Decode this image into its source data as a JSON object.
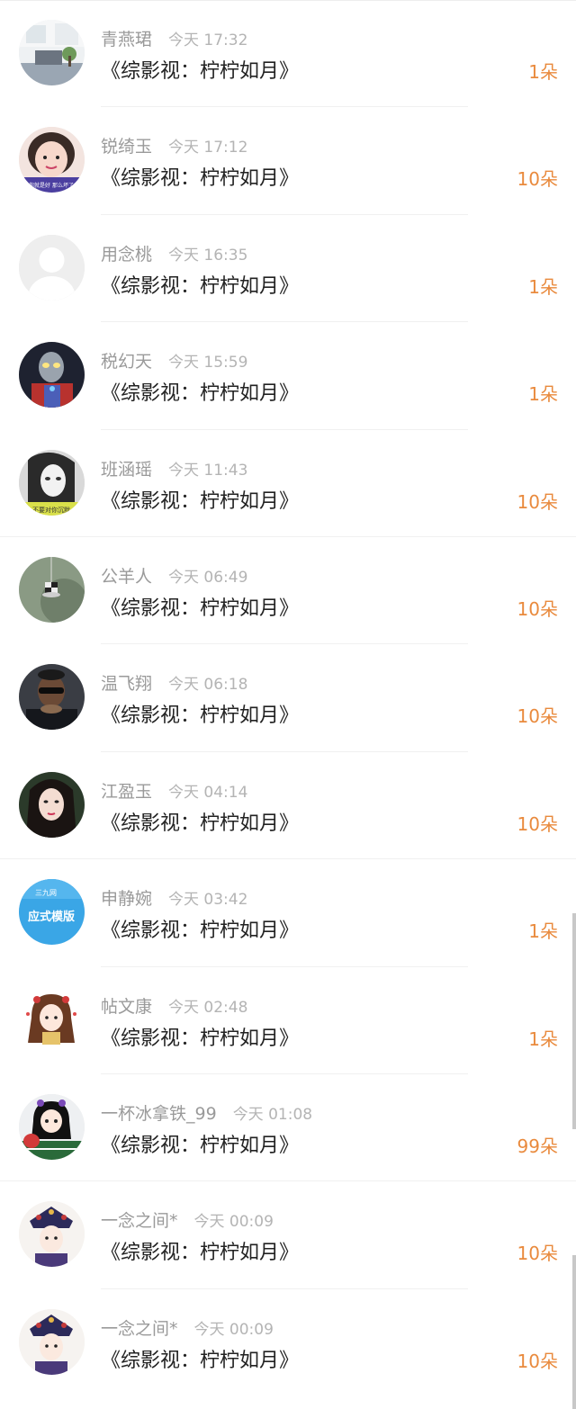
{
  "rows": [
    {
      "name": "青燕珺",
      "time": "今天 17:32",
      "title": "《综影视：柠柠如月》",
      "amount": "1朵",
      "avatar": "room-photo-avatar"
    },
    {
      "name": "锐绮玉",
      "time": "今天 17:12",
      "title": "《综影视：柠柠如月》",
      "amount": "10朵",
      "avatar": "girl-photo-avatar"
    },
    {
      "name": "用念桃",
      "time": "今天 16:35",
      "title": "《综影视：柠柠如月》",
      "amount": "1朵",
      "avatar": "default-avatar"
    },
    {
      "name": "税幻天",
      "time": "今天 15:59",
      "title": "《综影视：柠柠如月》",
      "amount": "1朵",
      "avatar": "ultraman-avatar"
    },
    {
      "name": "班涵瑶",
      "time": "今天 11:43",
      "title": "《综影视：柠柠如月》",
      "amount": "10朵",
      "avatar": "bw-woman-avatar"
    },
    {
      "name": "公羊人",
      "time": "今天 06:49",
      "title": "《综影视：柠柠如月》",
      "amount": "10朵",
      "avatar": "lamp-avatar"
    },
    {
      "name": "温飞翔",
      "time": "今天 06:18",
      "title": "《综影视：柠柠如月》",
      "amount": "10朵",
      "avatar": "man-sunglasses-avatar"
    },
    {
      "name": "江盈玉",
      "time": "今天 04:14",
      "title": "《综影视：柠柠如月》",
      "amount": "10朵",
      "avatar": "woman-portrait-avatar"
    },
    {
      "name": "申静婉",
      "time": "今天 03:42",
      "title": "《综影视：柠柠如月》",
      "amount": "1朵",
      "avatar": "blue-banner-avatar"
    },
    {
      "name": "帖文康",
      "time": "今天 02:48",
      "title": "《综影视：柠柠如月》",
      "amount": "1朵",
      "avatar": "cartoon-girl-avatar"
    },
    {
      "name": "一杯冰拿铁_99",
      "time": "今天 01:08",
      "title": "《综影视：柠柠如月》",
      "amount": "99朵",
      "avatar": "pingpong-girl-avatar"
    },
    {
      "name": "一念之间*",
      "time": "今天 00:09",
      "title": "《综影视：柠柠如月》",
      "amount": "10朵",
      "avatar": "qing-princess-avatar"
    },
    {
      "name": "一念之间*",
      "time": "今天 00:09",
      "title": "《综影视：柠柠如月》",
      "amount": "10朵",
      "avatar": "qing-princess-avatar"
    }
  ],
  "avatar_text": {
    "row2": "你就是好 那么坏了",
    "row5": "不要对你沉默",
    "row9_top": "三九网",
    "row9_main": "应式模版"
  },
  "colors": {
    "amount": "#e98a3d",
    "name": "#9a9a9a",
    "time": "#b4b4b4",
    "title": "#222222"
  }
}
